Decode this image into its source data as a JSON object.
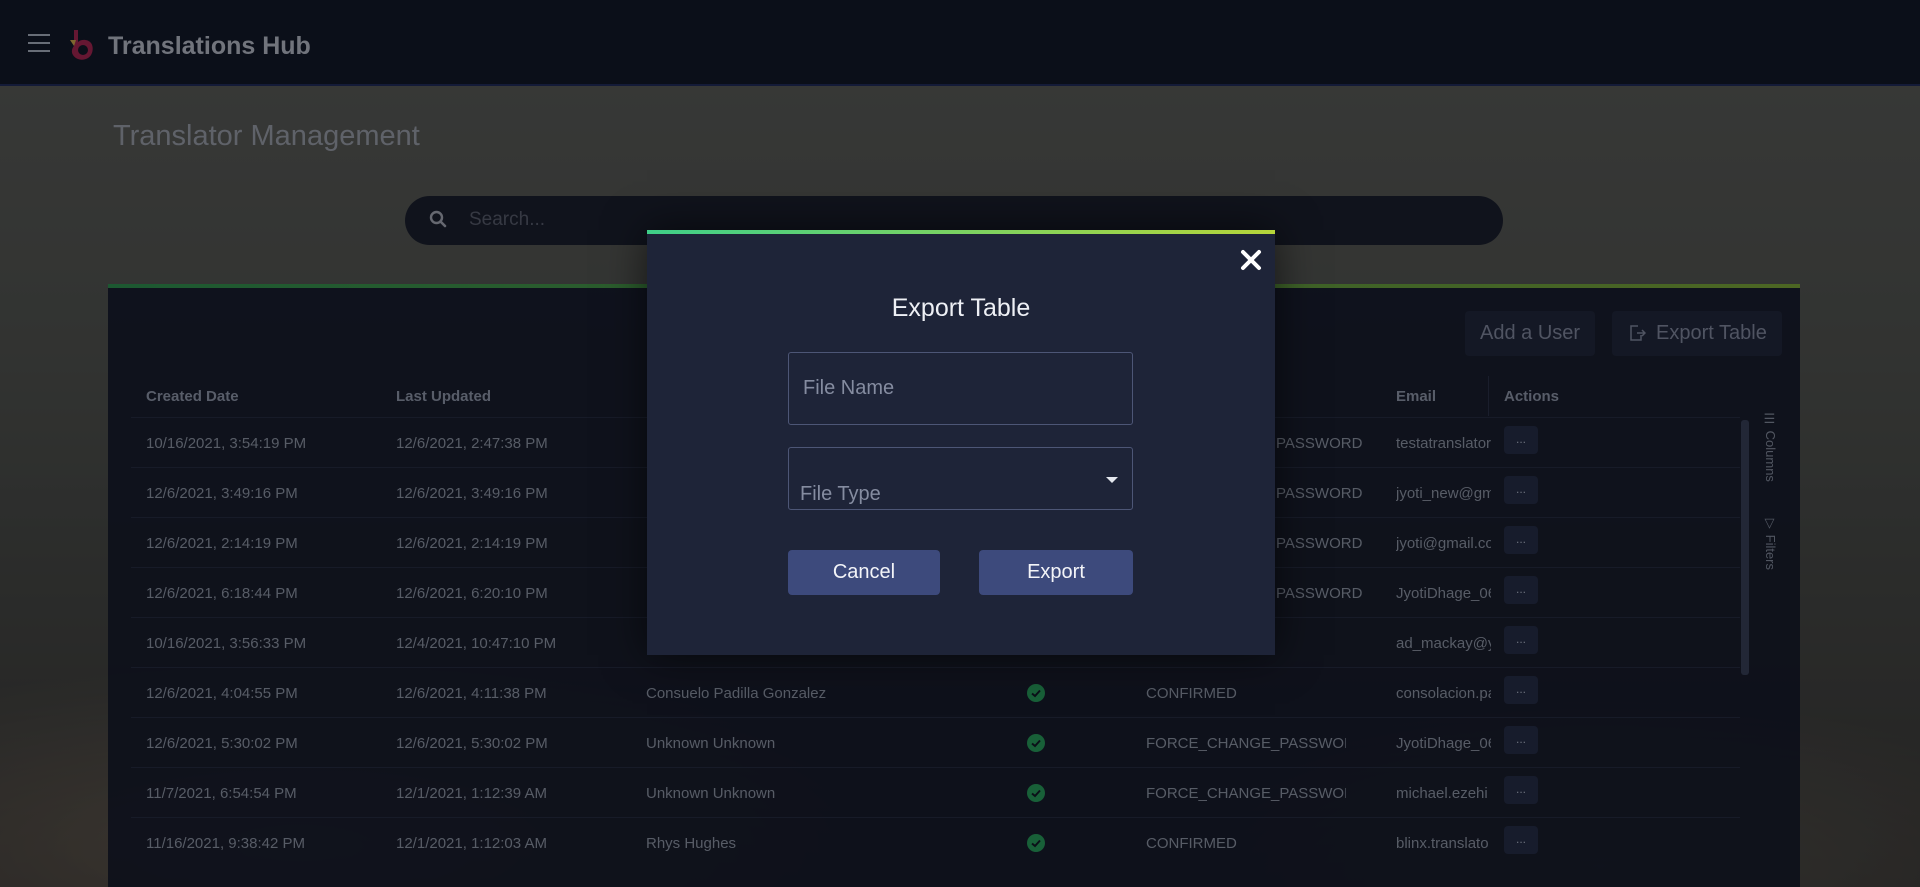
{
  "app": {
    "title": "Translations Hub"
  },
  "page": {
    "title": "Translator Management"
  },
  "search": {
    "placeholder": "Search..."
  },
  "toolbar": {
    "add_label": "Add a User",
    "export_label": "Export Table"
  },
  "table": {
    "columns": [
      "Created Date",
      "Last Updated",
      "",
      "",
      "",
      "Email",
      "Actions"
    ],
    "rows": [
      {
        "created": "10/16/2021, 3:54:19 PM",
        "updated": "12/6/2021, 2:47:38 PM",
        "name": "",
        "status": "PASSWORD",
        "email": "testatranslator",
        "action": "..."
      },
      {
        "created": "12/6/2021, 3:49:16 PM",
        "updated": "12/6/2021, 3:49:16 PM",
        "name": "",
        "status": "PASSWORD",
        "email": "jyoti_new@gm",
        "action": "..."
      },
      {
        "created": "12/6/2021, 2:14:19 PM",
        "updated": "12/6/2021, 2:14:19 PM",
        "name": "",
        "status": "PASSWORD",
        "email": "jyoti@gmail.co",
        "action": "..."
      },
      {
        "created": "12/6/2021, 6:18:44 PM",
        "updated": "12/6/2021, 6:20:10 PM",
        "name": "",
        "status": "PASSWORD",
        "email": "JyotiDhage_06",
        "action": "..."
      },
      {
        "created": "10/16/2021, 3:56:33 PM",
        "updated": "12/4/2021, 10:47:10 PM",
        "name": "",
        "status": "",
        "email": "ad_mackay@y",
        "action": "..."
      },
      {
        "created": "12/6/2021, 4:04:55 PM",
        "updated": "12/6/2021, 4:11:38 PM",
        "name": "Consuelo Padilla Gonzalez",
        "status": "CONFIRMED",
        "email": "consolacion.pa",
        "action": "..."
      },
      {
        "created": "12/6/2021, 5:30:02 PM",
        "updated": "12/6/2021, 5:30:02 PM",
        "name": "Unknown Unknown",
        "status": "FORCE_CHANGE_PASSWORD",
        "email": "JyotiDhage_06",
        "action": "..."
      },
      {
        "created": "11/7/2021, 6:54:54 PM",
        "updated": "12/1/2021, 1:12:39 AM",
        "name": "Unknown Unknown",
        "status": "FORCE_CHANGE_PASSWORD",
        "email": "michael.ezehi",
        "action": "..."
      },
      {
        "created": "11/16/2021, 9:38:42 PM",
        "updated": "12/1/2021, 1:12:03 AM",
        "name": "Rhys Hughes",
        "status": "CONFIRMED",
        "email": "blinx.translato",
        "action": "..."
      }
    ]
  },
  "side": {
    "columns_label": "Columns",
    "filters_label": "Filters"
  },
  "modal": {
    "title": "Export Table",
    "file_name_placeholder": "File Name",
    "file_type_label": "File Type",
    "cancel_label": "Cancel",
    "export_label": "Export"
  },
  "colors": {
    "accent_start": "#3fcf89",
    "accent_end": "#b6d53a",
    "button": "#3d4a7c",
    "check": "#27a85a"
  },
  "icons": [
    "menu-icon",
    "logo-icon",
    "search-icon",
    "export-icon",
    "close-icon",
    "check-icon",
    "columns-icon",
    "filter-icon",
    "caret-down-icon"
  ]
}
